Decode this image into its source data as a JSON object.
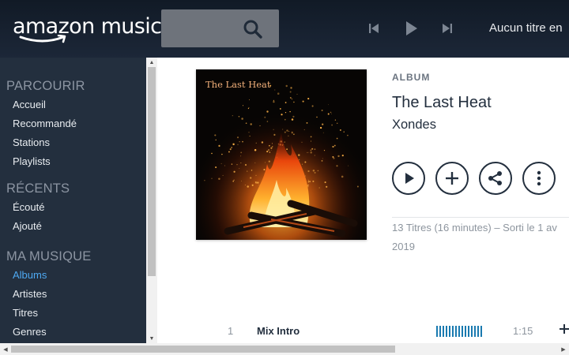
{
  "header": {
    "logo_text": "amazon music",
    "now_playing": "Aucun titre en"
  },
  "sidebar": {
    "sections": [
      {
        "title": "PARCOURIR",
        "items": [
          "Accueil",
          "Recommandé",
          "Stations",
          "Playlists"
        ]
      },
      {
        "title": "RÉCENTS",
        "items": [
          "Écouté",
          "Ajouté"
        ]
      },
      {
        "title": "MA MUSIQUE",
        "items": [
          "Albums",
          "Artistes",
          "Titres",
          "Genres"
        ]
      }
    ],
    "active_item": "Albums"
  },
  "album": {
    "label": "ALBUM",
    "title": "The Last Heat",
    "artist": "Xondes",
    "cover_text": "The Last Heat",
    "meta_line1": "13 Titres (16 minutes) – Sorti le 1 av",
    "meta_line2": "2019"
  },
  "tracks": [
    {
      "number": "1",
      "title": "Mix Intro",
      "duration": "1:15"
    }
  ],
  "colors": {
    "topbar": "#1c2738",
    "sidebar": "#232f3e",
    "active": "#4ea9f2",
    "sample_bars": "#1a7ab0"
  },
  "icons": [
    "search-icon",
    "previous-icon",
    "play-icon",
    "next-icon",
    "add-icon",
    "share-icon",
    "more-icon"
  ]
}
